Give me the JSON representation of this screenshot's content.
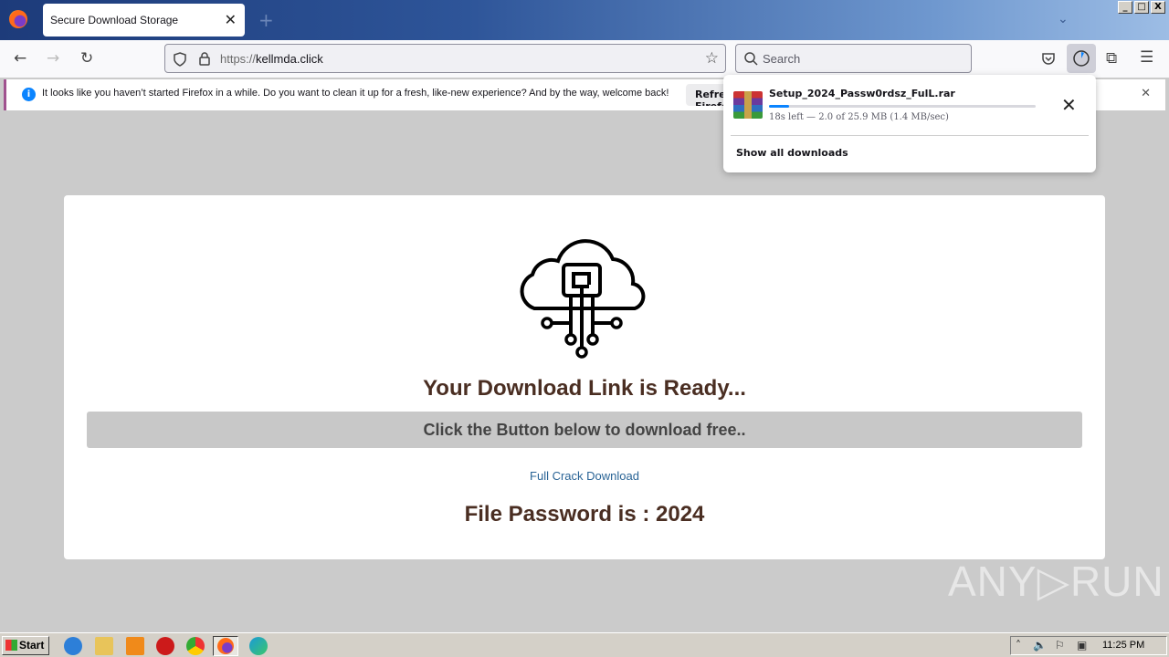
{
  "browser": {
    "tab_title": "Secure Download Storage",
    "new_tab_icon": "plus-icon",
    "url_scheme": "https://",
    "url_host": "kellmda.click",
    "search_placeholder": "Search",
    "window_buttons": [
      "_",
      "□",
      "X"
    ]
  },
  "notification": {
    "text": "It looks like you haven’t started Firefox in a while. Do you want to clean it up for a fresh, like-new experience? And by the way, welcome back!",
    "button_label": "Refresh Firefox"
  },
  "downloads_panel": {
    "filename": "Setup_2024_Passw0rdsz_FulL.rar",
    "status": "18s left — 2.0 of 25.9 MB (1.4 MB/sec)",
    "progress_percent": 7.7,
    "show_all_label": "Show all downloads"
  },
  "page": {
    "heading": "Your Download Link is Ready...",
    "bar_text": "Click the Button below to download free..",
    "link_text": "Full Crack Download",
    "password_text": "File Password is : 2024"
  },
  "watermark": "ANY▷RUN",
  "taskbar": {
    "start_label": "Start",
    "clock": "11:25 PM"
  }
}
